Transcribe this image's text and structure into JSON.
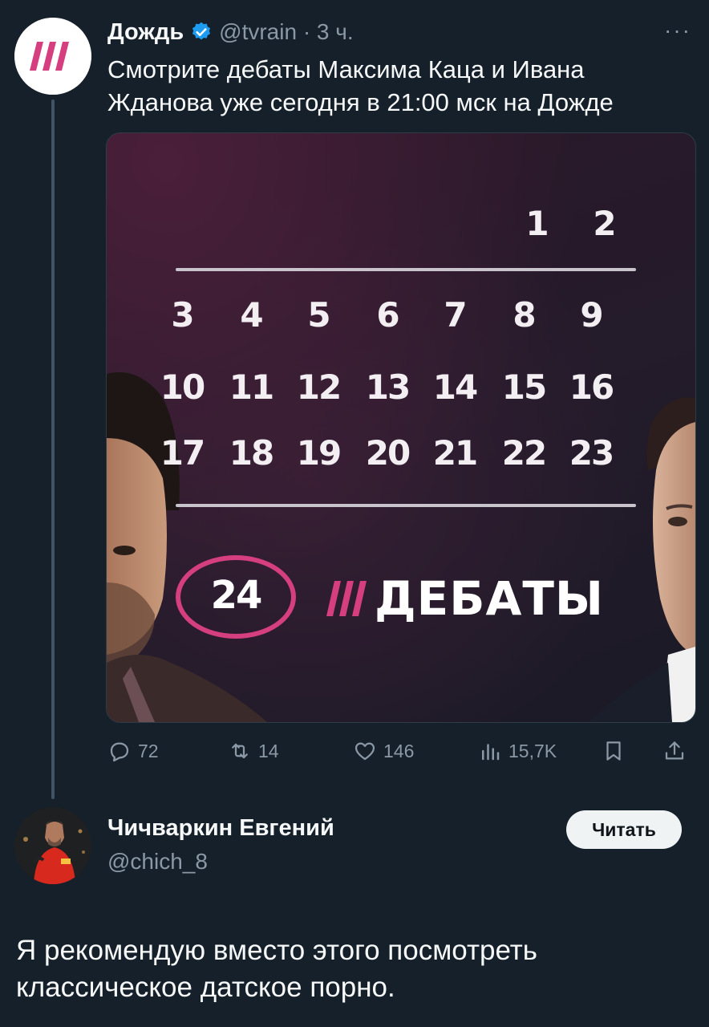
{
  "tweet": {
    "author_name": "Дождь",
    "author_handle": "@tvrain · 3 ч.",
    "more_label": "···",
    "text": "Смотрите дебаты Максима Каца и Ивана Жданова уже сегодня в 21:00 мск на Дожде",
    "media": {
      "calendar_top": [
        "1",
        "2"
      ],
      "calendar_rows": [
        [
          "3",
          "4",
          "5",
          "6",
          "7",
          "8",
          "9"
        ],
        [
          "10",
          "11",
          "12",
          "13",
          "14",
          "15",
          "16"
        ],
        [
          "17",
          "18",
          "19",
          "20",
          "21",
          "22",
          "23"
        ]
      ],
      "highlight_day": "24",
      "brand_word": "ДЕБАТЫ",
      "accent_color": "#d63f7f"
    },
    "actions": {
      "replies": "72",
      "retweets": "14",
      "likes": "146",
      "views": "15,7K"
    }
  },
  "reply": {
    "author_name": "Чичваркин Евгений",
    "author_handle": "@chich_8",
    "follow_label": "Читать",
    "text": "Я рекомендую вместо этого посмотреть классическое датское порно."
  },
  "colors": {
    "background": "#15202b",
    "verified": "#1d9bf0",
    "secondary_text": "#8b98a5",
    "brand_pink": "#d63f7f"
  }
}
